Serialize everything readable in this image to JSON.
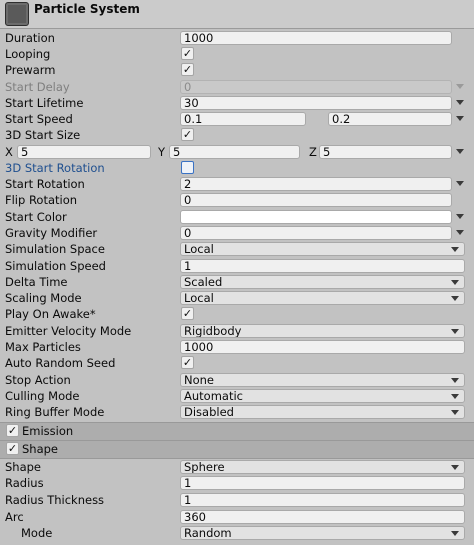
{
  "header": {
    "title": "Particle System"
  },
  "rows": [
    {
      "label": "Duration",
      "value": "1000"
    },
    {
      "label": "Looping",
      "check": "✓"
    },
    {
      "label": "Prewarm",
      "check": "✓"
    },
    {
      "label": "Start Delay",
      "value": "0"
    },
    {
      "label": "Start Lifetime",
      "value": "30"
    },
    {
      "label": "Start Speed",
      "value": "0.1",
      "value2": "0.2"
    },
    {
      "label": "3D Start Size",
      "check": "✓"
    },
    {
      "label": "",
      "axis_x": "X",
      "x": "5",
      "axis_y": "Y",
      "y": "5",
      "axis_z": "Z",
      "z": "5"
    },
    {
      "label": "3D Start Rotation",
      "check": ""
    },
    {
      "label": "Start Rotation",
      "value": "2"
    },
    {
      "label": "Flip Rotation",
      "value": "0"
    },
    {
      "label": "Start Color",
      "value": ""
    },
    {
      "label": "Gravity Modifier",
      "value": "0"
    },
    {
      "label": "Simulation Space",
      "value": "Local"
    },
    {
      "label": "Simulation Speed",
      "value": "1"
    },
    {
      "label": "Delta Time",
      "value": "Scaled"
    },
    {
      "label": "Scaling Mode",
      "value": "Local"
    },
    {
      "label": "Play On Awake*",
      "check": "✓"
    },
    {
      "label": "Emitter Velocity Mode",
      "value": "Rigidbody"
    },
    {
      "label": "Max Particles",
      "value": "1000"
    },
    {
      "label": "Auto Random Seed",
      "check": "✓"
    },
    {
      "label": "Stop Action",
      "value": "None"
    },
    {
      "label": "Culling Mode",
      "value": "Automatic"
    },
    {
      "label": "Ring Buffer Mode",
      "value": "Disabled"
    }
  ],
  "sections": [
    {
      "title": "Emission",
      "check": "✓"
    },
    {
      "title": "Shape",
      "check": "✓"
    }
  ],
  "shape_rows": [
    {
      "label": "Shape",
      "value": "Sphere"
    },
    {
      "label": "Radius",
      "value": "1"
    },
    {
      "label": "Radius Thickness",
      "value": "1"
    },
    {
      "label": "Arc",
      "value": "360"
    },
    {
      "label": "Mode",
      "value": "Random"
    }
  ]
}
